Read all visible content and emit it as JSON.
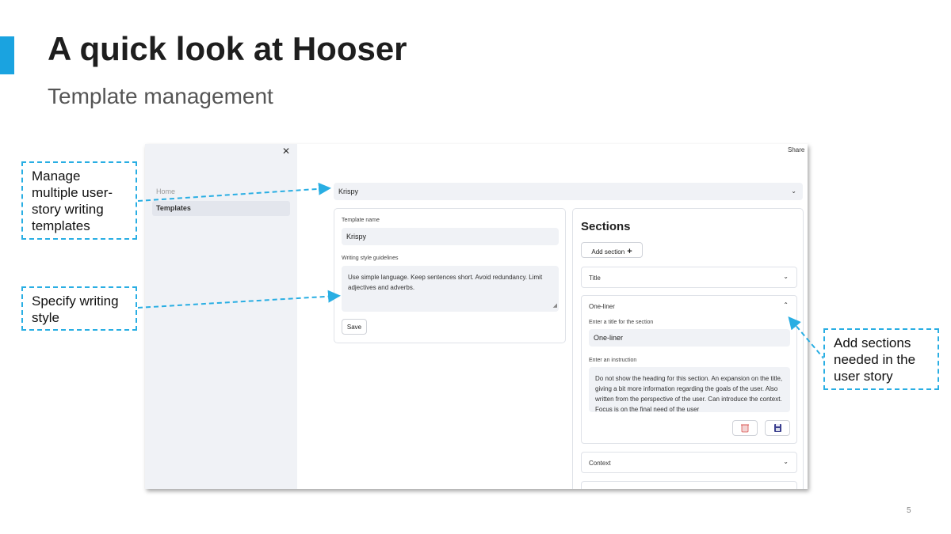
{
  "slide": {
    "title": "A quick look at Hooser",
    "subtitle": "Template management",
    "page_number": "5",
    "accent_color": "#1aa3e0"
  },
  "callouts": {
    "templates": "Manage multiple user-story writing templates",
    "style": "Specify writing style",
    "sections": "Add sections needed in the user story"
  },
  "app": {
    "sidebar": {
      "close_icon": "close-icon",
      "items": [
        {
          "label": "Home",
          "active": false
        },
        {
          "label": "Templates",
          "active": true
        }
      ]
    },
    "header": {
      "share_label": "Share"
    },
    "template_select": {
      "value": "Krispy",
      "icon": "chevron-down-icon"
    },
    "template_form": {
      "name_label": "Template name",
      "name_value": "Krispy",
      "guidelines_label": "Writing style guidelines",
      "guidelines_value": "Use simple language. Keep sentences short. Avoid redundancy. Limit adjectives and adverbs.",
      "save_label": "Save"
    },
    "sections": {
      "heading": "Sections",
      "add_label": "Add section",
      "add_icon": "plus-icon",
      "items": [
        {
          "title": "Title",
          "expanded": false
        },
        {
          "title": "One-liner",
          "expanded": true,
          "title_field_label": "Enter a title for the section",
          "title_value": "One-liner",
          "instruction_label": "Enter an instruction",
          "instruction_value": "Do not show the heading for this section. An expansion on the title, giving a bit more information regarding the goals of the user. Also written from the perspective of the user. Can introduce the context. Focus is on the final need of the user",
          "delete_icon": "trash-icon",
          "save_icon": "floppy-disk-icon"
        },
        {
          "title": "Context",
          "expanded": false
        }
      ]
    }
  }
}
